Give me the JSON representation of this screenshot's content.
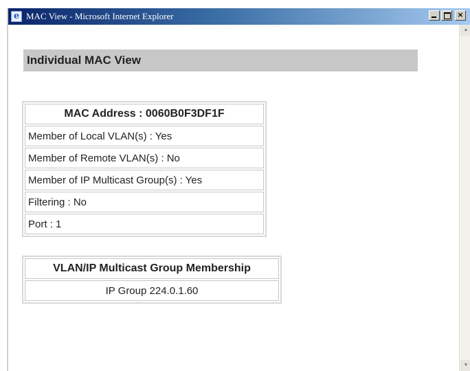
{
  "window": {
    "title": "MAC View - Microsoft Internet Explorer",
    "controls": {
      "minimize": "_",
      "maximize": "□",
      "close": "×"
    }
  },
  "page": {
    "heading": "Individual MAC View",
    "mac_table": {
      "header": "MAC Address : 0060B0F3DF1F",
      "rows": [
        "Member of Local VLAN(s) : Yes",
        "Member of Remote VLAN(s) : No",
        "Member of IP Multicast Group(s) : Yes",
        "Filtering : No",
        "Port : 1"
      ]
    },
    "membership_table": {
      "header": "VLAN/IP Multicast Group Membership",
      "rows": [
        "IP Group 224.0.1.60"
      ]
    }
  },
  "icons": {
    "app": "internet-explorer-icon",
    "scroll_up": "arrow-up-icon",
    "scroll_down": "arrow-down-icon"
  },
  "colors": {
    "titlebar_start": "#0a246a",
    "titlebar_end": "#a6caf0",
    "heading_bg": "#c8c8c8"
  }
}
